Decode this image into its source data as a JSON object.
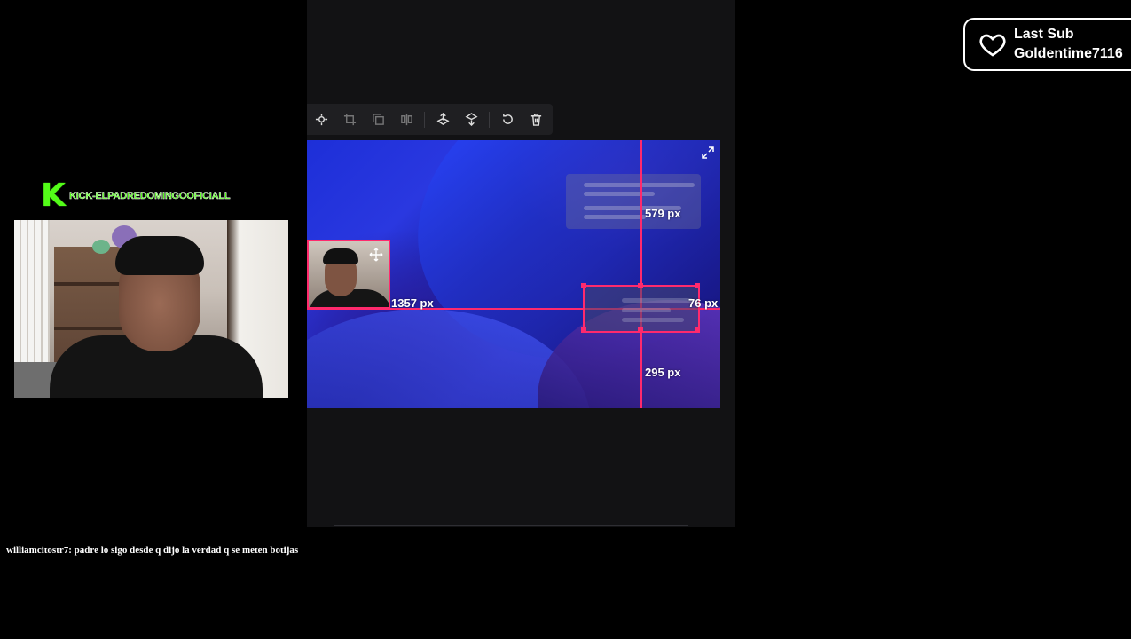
{
  "stream_overlay": {
    "kick_channel": "KICK-ELPADREDOMINGOOFICIALL",
    "kick_logo": "K",
    "chat_message": "williamcitostr7: padre lo sigo desde q dijo la verdad q se meten botijas"
  },
  "last_sub": {
    "icon": "heart-icon",
    "title": "Last Sub",
    "username": "Goldentime7116"
  },
  "editor": {
    "toolbar": {
      "tools": [
        {
          "name": "center-icon",
          "enabled": true
        },
        {
          "name": "crop-icon",
          "enabled": false
        },
        {
          "name": "duplicate-icon",
          "enabled": false
        },
        {
          "name": "flip-icon",
          "enabled": false
        },
        {
          "name": "bring-forward-icon",
          "enabled": true
        },
        {
          "name": "send-backward-icon",
          "enabled": true
        },
        {
          "name": "reset-icon",
          "enabled": true
        },
        {
          "name": "delete-icon",
          "enabled": true
        }
      ]
    },
    "canvas": {
      "measurements": {
        "top": "579 px",
        "left": "1357 px",
        "right": "76 px",
        "bottom": "295 px"
      },
      "accent_color": "#ff2a6d"
    }
  }
}
